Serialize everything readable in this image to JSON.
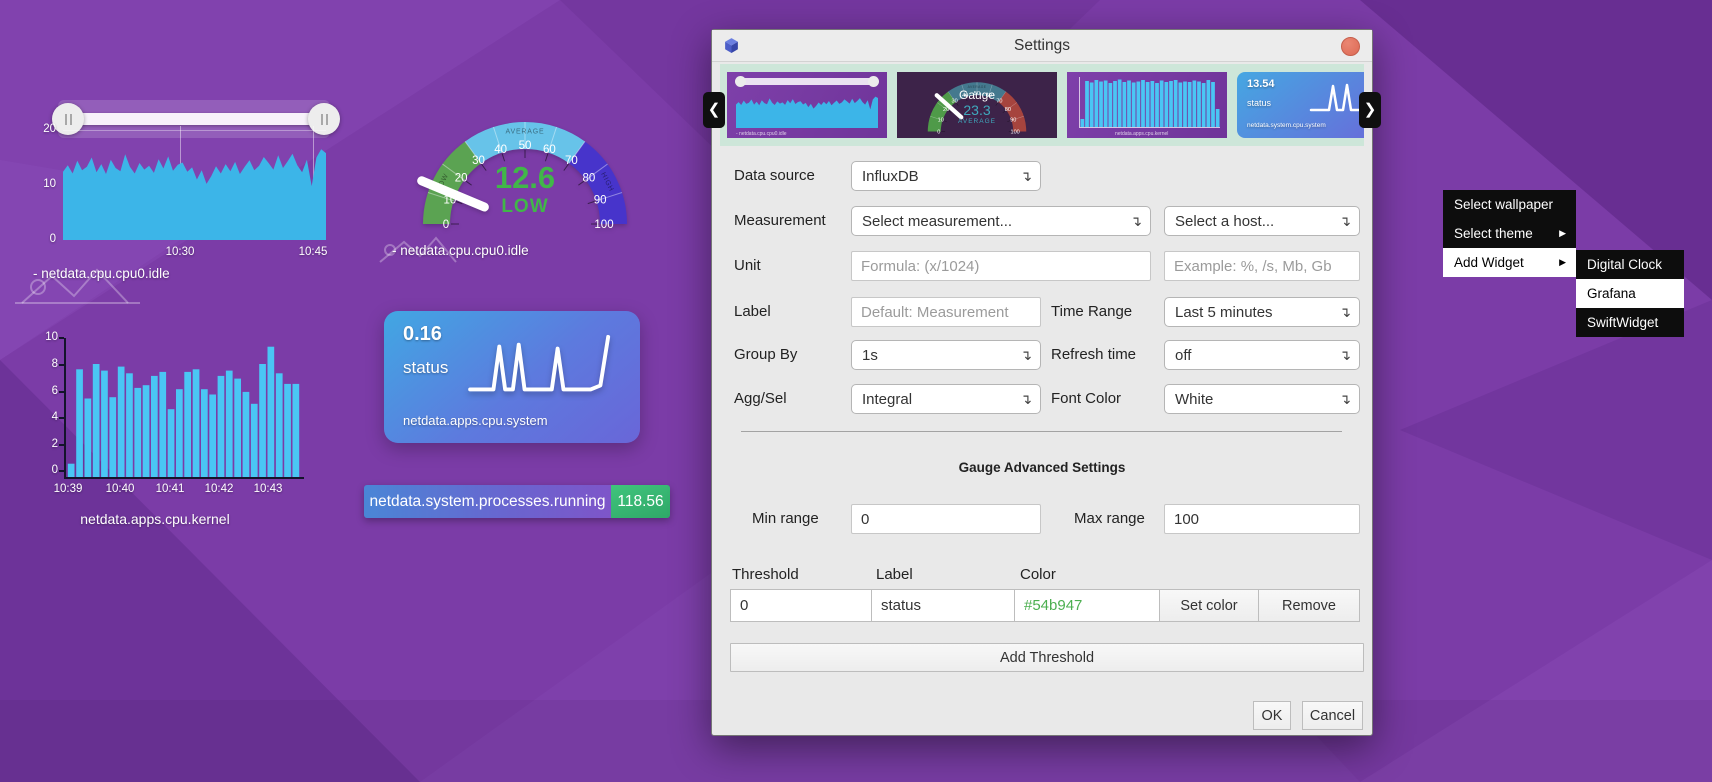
{
  "dialog": {
    "title": "Settings",
    "dropdown_glyph": "↴",
    "carousel": {
      "prev": "❮",
      "next": "❯"
    },
    "form": {
      "data_source": {
        "label": "Data source",
        "value": "InfluxDB"
      },
      "measurement": {
        "label": "Measurement",
        "value": "Select measurement...",
        "host_value": "Select a host..."
      },
      "unit": {
        "label": "Unit",
        "formula_placeholder": "Formula: (x/1024)",
        "example_placeholder": "Example: %, /s, Mb, Gb"
      },
      "label_field": {
        "label": "Label",
        "placeholder": "Default: Measurement"
      },
      "time_range": {
        "label": "Time Range",
        "value": "Last 5 minutes"
      },
      "group_by": {
        "label": "Group By",
        "value": "1s"
      },
      "refresh_time": {
        "label": "Refresh time",
        "value": "off"
      },
      "agg_sel": {
        "label": "Agg/Sel",
        "value": "Integral"
      },
      "font_color": {
        "label": "Font Color",
        "value": "White"
      }
    },
    "advanced": {
      "heading": "Gauge Advanced Settings",
      "min_range": {
        "label": "Min range",
        "value": "0"
      },
      "max_range": {
        "label": "Max range",
        "value": "100"
      }
    },
    "threshold": {
      "headers": {
        "threshold": "Threshold",
        "label": "Label",
        "color": "Color"
      },
      "row": {
        "threshold": "0",
        "label": "status",
        "color": "#54b947"
      },
      "set_color": "Set color",
      "remove": "Remove",
      "add": "Add Threshold"
    },
    "footer": {
      "ok": "OK",
      "cancel": "Cancel"
    }
  },
  "menu": {
    "arrow": "▶",
    "items": [
      {
        "label": "Select wallpaper"
      },
      {
        "label": "Select theme"
      },
      {
        "label": "Add Widget"
      }
    ],
    "submenu": [
      {
        "label": "Digital Clock"
      },
      {
        "label": "Grafana"
      },
      {
        "label": "SwiftWidget"
      }
    ]
  },
  "chart_data": [
    {
      "id": "cpu_idle_area",
      "type": "area",
      "title": "- netdata.cpu.cpu0.idle",
      "xlabel": "",
      "ylabel": "",
      "ylim": [
        0,
        20
      ],
      "y_ticks": [
        "20",
        "10",
        "0"
      ],
      "x_ticks": [
        "10:30",
        "10:45"
      ],
      "color": "#3cb5e8",
      "values": [
        12.4,
        13.6,
        12.1,
        14.4,
        12.7,
        13.3,
        15.0,
        12.3,
        13.8,
        12.0,
        14.6,
        13.1,
        12.5,
        15.6,
        13.3,
        12.1,
        14.0,
        12.8,
        13.5,
        12.2,
        14.7,
        13.0,
        15.2,
        12.6,
        13.7,
        14.1,
        12.4,
        13.2,
        11.0,
        12.7,
        10.2,
        11.6,
        13.4,
        12.1,
        13.8,
        12.5,
        14.2,
        12.0,
        13.3,
        14.5,
        12.7,
        13.5,
        15.1,
        14.0,
        12.8,
        15.4,
        13.1,
        14.3,
        15.7,
        13.6,
        12.3,
        14.6,
        9.8,
        15.0,
        16.5,
        15.8
      ]
    },
    {
      "id": "cpu_idle_gauge",
      "type": "gauge",
      "title": "- netdata.cpu.cpu0.idle",
      "value": 12.6,
      "display": "12.6",
      "state": "LOW",
      "min": 0,
      "max": 100,
      "tick_step": 10,
      "value_color": "#41b649",
      "needle_color": "#ffffff",
      "zones": [
        {
          "from": 0,
          "to": 30,
          "color": "#5ba352",
          "label": "LOW"
        },
        {
          "from": 30,
          "to": 70,
          "color": "#67c3e9",
          "label": "AVERAGE"
        },
        {
          "from": 70,
          "to": 100,
          "color": "#4734cb",
          "label": "HIGH"
        }
      ]
    },
    {
      "id": "apps_cpu_kernel_bars",
      "type": "bar",
      "title": "netdata.apps.cpu.kernel",
      "ylim": [
        0,
        10
      ],
      "y_ticks": [
        "10",
        "8",
        "6",
        "4",
        "2",
        "0"
      ],
      "x_ticks": [
        "10:39",
        "10:40",
        "10:41",
        "10:42",
        "10:43"
      ],
      "color": "#4ac6f4",
      "values": [
        1.0,
        8.1,
        5.9,
        8.5,
        8.0,
        6.0,
        8.3,
        7.8,
        6.7,
        6.9,
        7.6,
        7.9,
        5.1,
        6.6,
        7.9,
        8.1,
        6.6,
        6.2,
        7.6,
        8.0,
        7.4,
        6.4,
        5.5,
        8.5,
        9.8,
        7.8,
        7.0,
        7.0
      ]
    },
    {
      "id": "apps_cpu_system_spark",
      "type": "line",
      "value": "0.16",
      "label": "status",
      "metric": "netdata.apps.cpu.system",
      "stroke": "#ffffff",
      "stroke_width": 4,
      "points": [
        [
          4,
          58
        ],
        [
          28,
          58
        ],
        [
          34,
          14
        ],
        [
          40,
          58
        ],
        [
          48,
          58
        ],
        [
          54,
          12
        ],
        [
          60,
          58
        ],
        [
          88,
          58
        ],
        [
          94,
          16
        ],
        [
          100,
          58
        ],
        [
          128,
          58
        ],
        [
          138,
          54
        ],
        [
          146,
          4
        ]
      ]
    },
    {
      "id": "processes_pill",
      "type": "value",
      "metric": "netdata.system.processes.running",
      "value": "118.56",
      "value_bg": "#3bbf75",
      "metric_bg_from": "#4a86d6",
      "metric_bg_to": "#7e55c9"
    },
    {
      "id": "thumb_gauge",
      "type": "gauge",
      "title_text": "Gauge",
      "display": "23.3",
      "state": "AVERAGE",
      "value": 23.3,
      "min": 0,
      "max": 100,
      "tick_step": 10,
      "value_color": "#3fa9bd",
      "needle_color": "#ffffff",
      "zones": [
        {
          "from": 0,
          "to": 30,
          "color": "#4f9a49",
          "label": ""
        },
        {
          "from": 30,
          "to": 70,
          "color": "#44798e",
          "label": "AVERAGE"
        },
        {
          "from": 70,
          "to": 100,
          "color": "#a6443e",
          "label": ""
        }
      ]
    },
    {
      "id": "thumb_bars",
      "type": "bar",
      "ylim": [
        0,
        10
      ],
      "color": "#4ac6f4",
      "values": [
        1.6,
        9.2,
        8.9,
        9.4,
        9.1,
        9.3,
        8.8,
        9.2,
        9.5,
        9.0,
        9.3,
        8.9,
        9.1,
        9.4,
        9.0,
        9.2,
        8.8,
        9.3,
        9.0,
        9.2,
        9.4,
        8.9,
        9.1,
        9.0,
        9.3,
        9.1,
        8.8,
        9.4,
        9.0,
        3.6
      ]
    },
    {
      "id": "thumb_spark",
      "type": "line",
      "value": "13.54",
      "label": "status",
      "metric": "netdata.system.cpu.system",
      "stroke": "#ffffff",
      "stroke_width": 2.5,
      "points": [
        [
          2,
          32
        ],
        [
          20,
          32
        ],
        [
          24,
          8
        ],
        [
          28,
          32
        ],
        [
          34,
          32
        ],
        [
          38,
          7
        ],
        [
          42,
          32
        ],
        [
          58,
          32
        ],
        [
          70,
          28
        ],
        [
          76,
          2
        ]
      ]
    }
  ]
}
